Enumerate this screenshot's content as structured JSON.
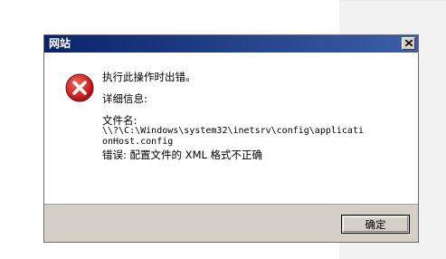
{
  "dialog": {
    "title": "网站",
    "close_icon": "close-icon",
    "error_icon": "error-icon",
    "message": "执行此操作时出错。",
    "details_label": "详细信息:",
    "file_label": "文件名:",
    "file_path": "\\\\?\\C:\\Windows\\system32\\inetsrv\\config\\applicationHost.config",
    "error_text": "错误: 配置文件的 XML 格式不正确",
    "ok_label": "确定"
  },
  "colors": {
    "titlebar": "#0a246a",
    "footer": "#d4d0c8",
    "error_red": "#d42222"
  }
}
